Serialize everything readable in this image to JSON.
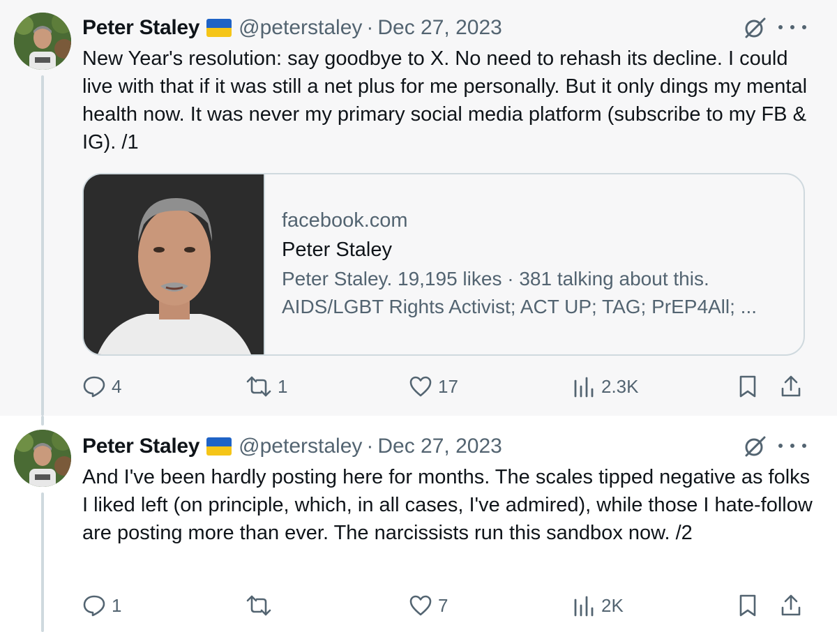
{
  "posts": [
    {
      "name": "Peter Staley",
      "handle": "@peterstaley",
      "separator": "·",
      "date": "Dec 27, 2023",
      "text": "New Year's resolution: say goodbye to X. No need to rehash its decline. I could live with that if it was still a net plus for me personally. But it only dings my mental health now. It was never my primary social media platform (subscribe to my FB & IG). /1",
      "link_card": {
        "domain": "facebook.com",
        "title": "Peter Staley",
        "description_line1": "Peter Staley. 19,195 likes · 381 talking about this.",
        "description_line2": "AIDS/LGBT Rights Activist; ACT UP; TAG; PrEP4All; ..."
      },
      "stats": {
        "replies": "4",
        "reposts": "1",
        "likes": "17",
        "views": "2.3K"
      }
    },
    {
      "name": "Peter Staley",
      "handle": "@peterstaley",
      "separator": "·",
      "date": "Dec 27, 2023",
      "text": "And I've been hardly posting here for months. The scales tipped negative as folks I liked left (on principle, which, in all cases, I've admired), while those I hate-follow are posting more than ever. The narcissists run this sandbox now. /2",
      "stats": {
        "replies": "1",
        "reposts": "",
        "likes": "7",
        "views": "2K"
      }
    }
  ],
  "icons": {
    "flag": "ukraine-flag-emoji",
    "grok": "grok-icon",
    "more": "more-horizontal-icon",
    "reply": "reply-icon",
    "repost": "repost-icon",
    "like": "heart-icon",
    "views": "views-chart-icon",
    "bookmark": "bookmark-icon",
    "share": "share-icon"
  },
  "colors": {
    "text_primary": "#0f1419",
    "text_secondary": "#536471",
    "border": "#cfd9de",
    "post1_background": "#f7f7f8",
    "flag_blue": "#1f63c6",
    "flag_yellow": "#f5c518"
  }
}
